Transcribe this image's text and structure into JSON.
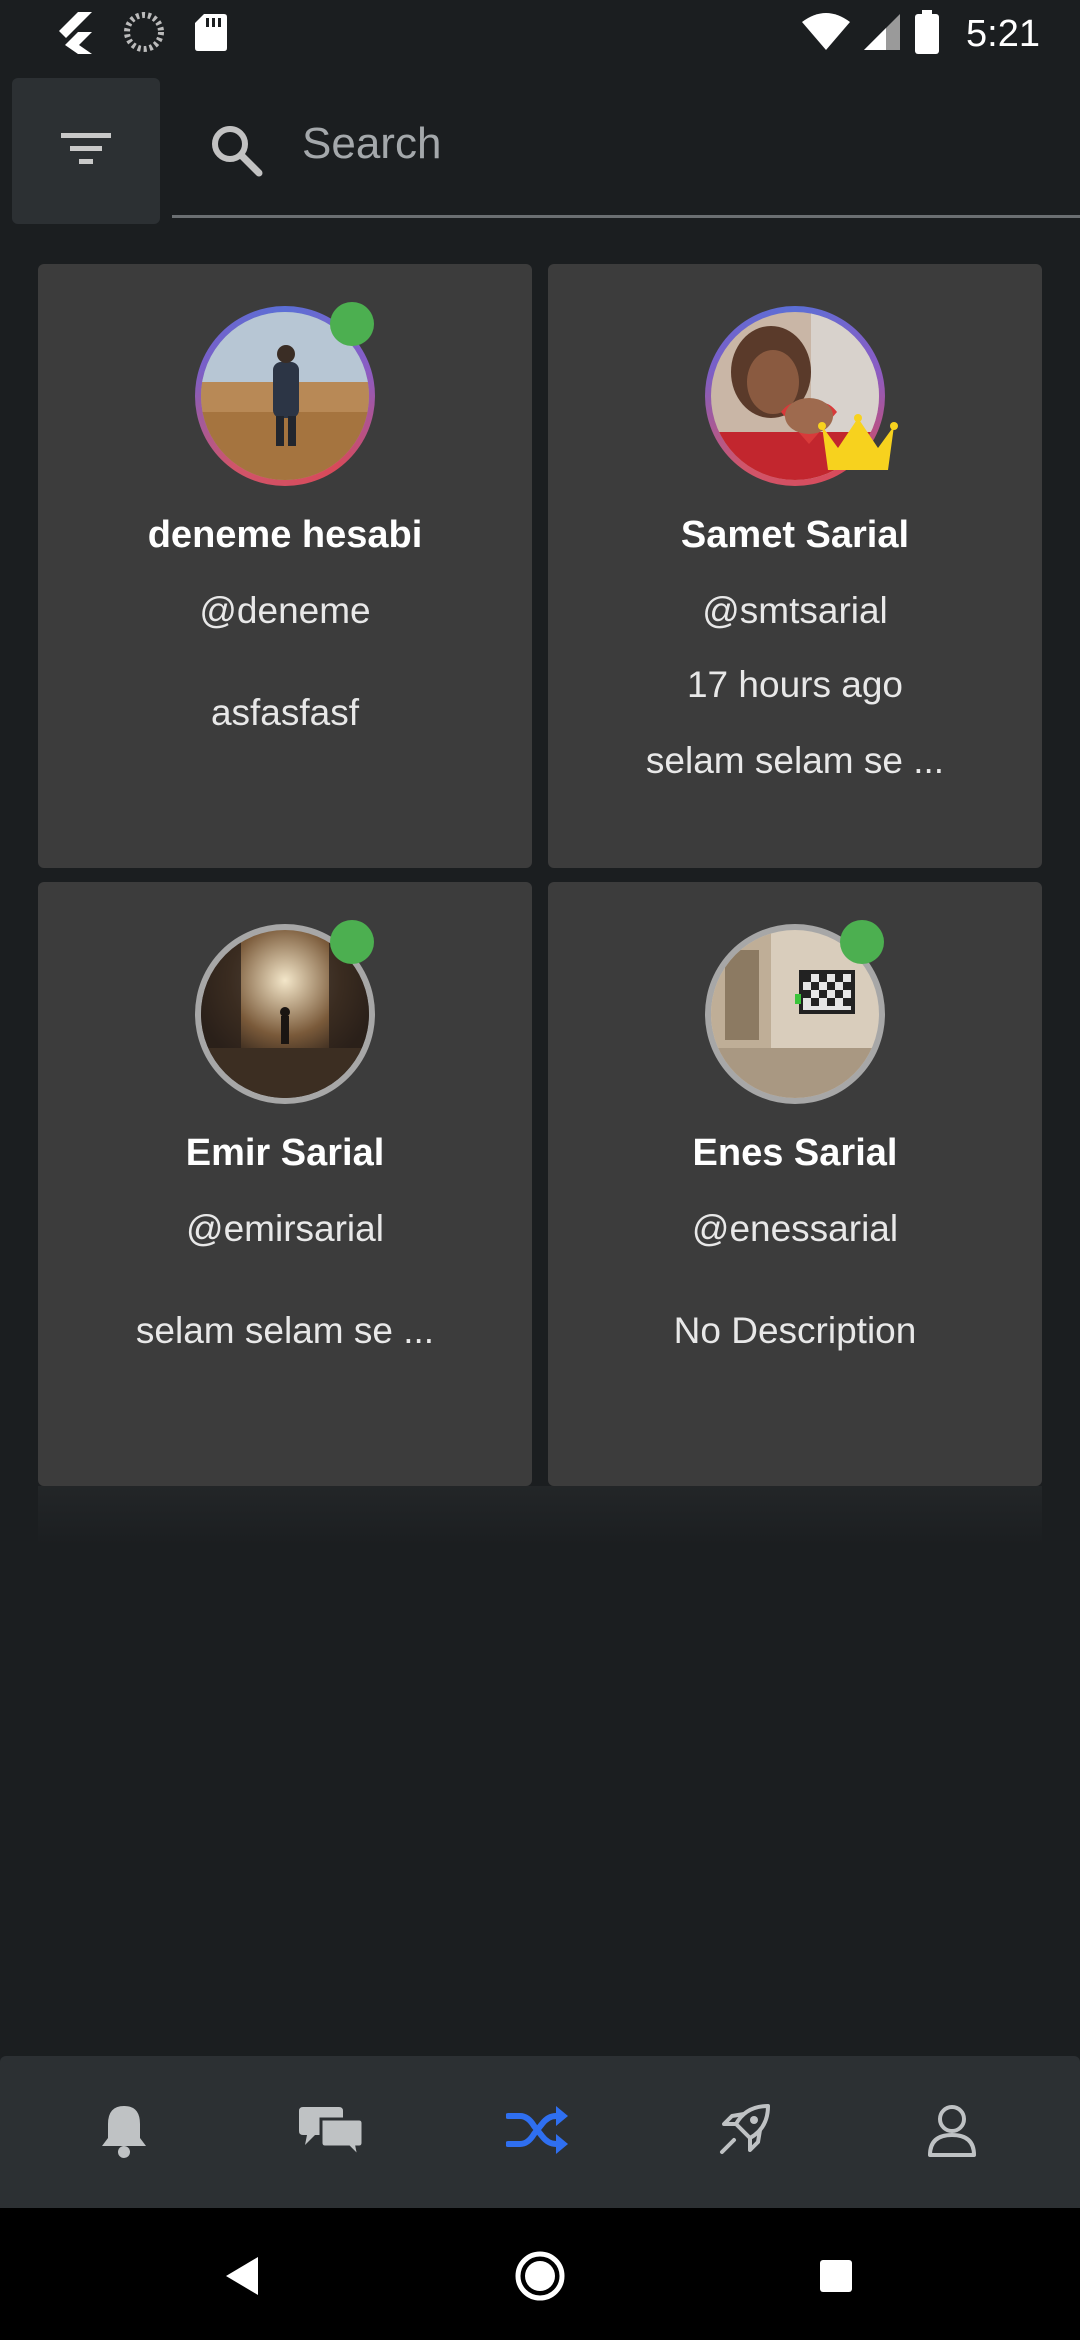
{
  "status_bar": {
    "time": "5:21",
    "icons": [
      "flutter-icon",
      "loading-icon",
      "sd-card-icon",
      "wifi-icon",
      "signal-icon",
      "battery-icon"
    ]
  },
  "search": {
    "placeholder": "Search",
    "value": ""
  },
  "filter_button": {
    "icon": "filter-icon"
  },
  "cards": [
    {
      "name": "deneme hesabi",
      "handle": "@deneme",
      "time": "",
      "description": "asfasfasf",
      "online": true,
      "premium": false
    },
    {
      "name": "Samet Sarial",
      "handle": "@smtsarial",
      "time": "17 hours ago",
      "description": "selam selam se ...",
      "online": false,
      "premium": true
    },
    {
      "name": "Emir Sarial",
      "handle": "@emirsarial",
      "time": "",
      "description": "selam selam se ...",
      "online": true,
      "premium": false
    },
    {
      "name": "Enes Sarial",
      "handle": "@enessarial",
      "time": "",
      "description": "No Description",
      "online": true,
      "premium": false
    }
  ],
  "bottom_nav": {
    "items": [
      {
        "icon": "bell-icon",
        "active": false
      },
      {
        "icon": "chat-icon",
        "active": false
      },
      {
        "icon": "shuffle-icon",
        "active": true
      },
      {
        "icon": "rocket-icon",
        "active": false
      },
      {
        "icon": "profile-icon",
        "active": false
      }
    ]
  },
  "colors": {
    "background": "#1b1e20",
    "card": "#3c3c3c",
    "accent": "#2f6ff0",
    "online": "#4caf50",
    "crown": "#f7d21e"
  }
}
